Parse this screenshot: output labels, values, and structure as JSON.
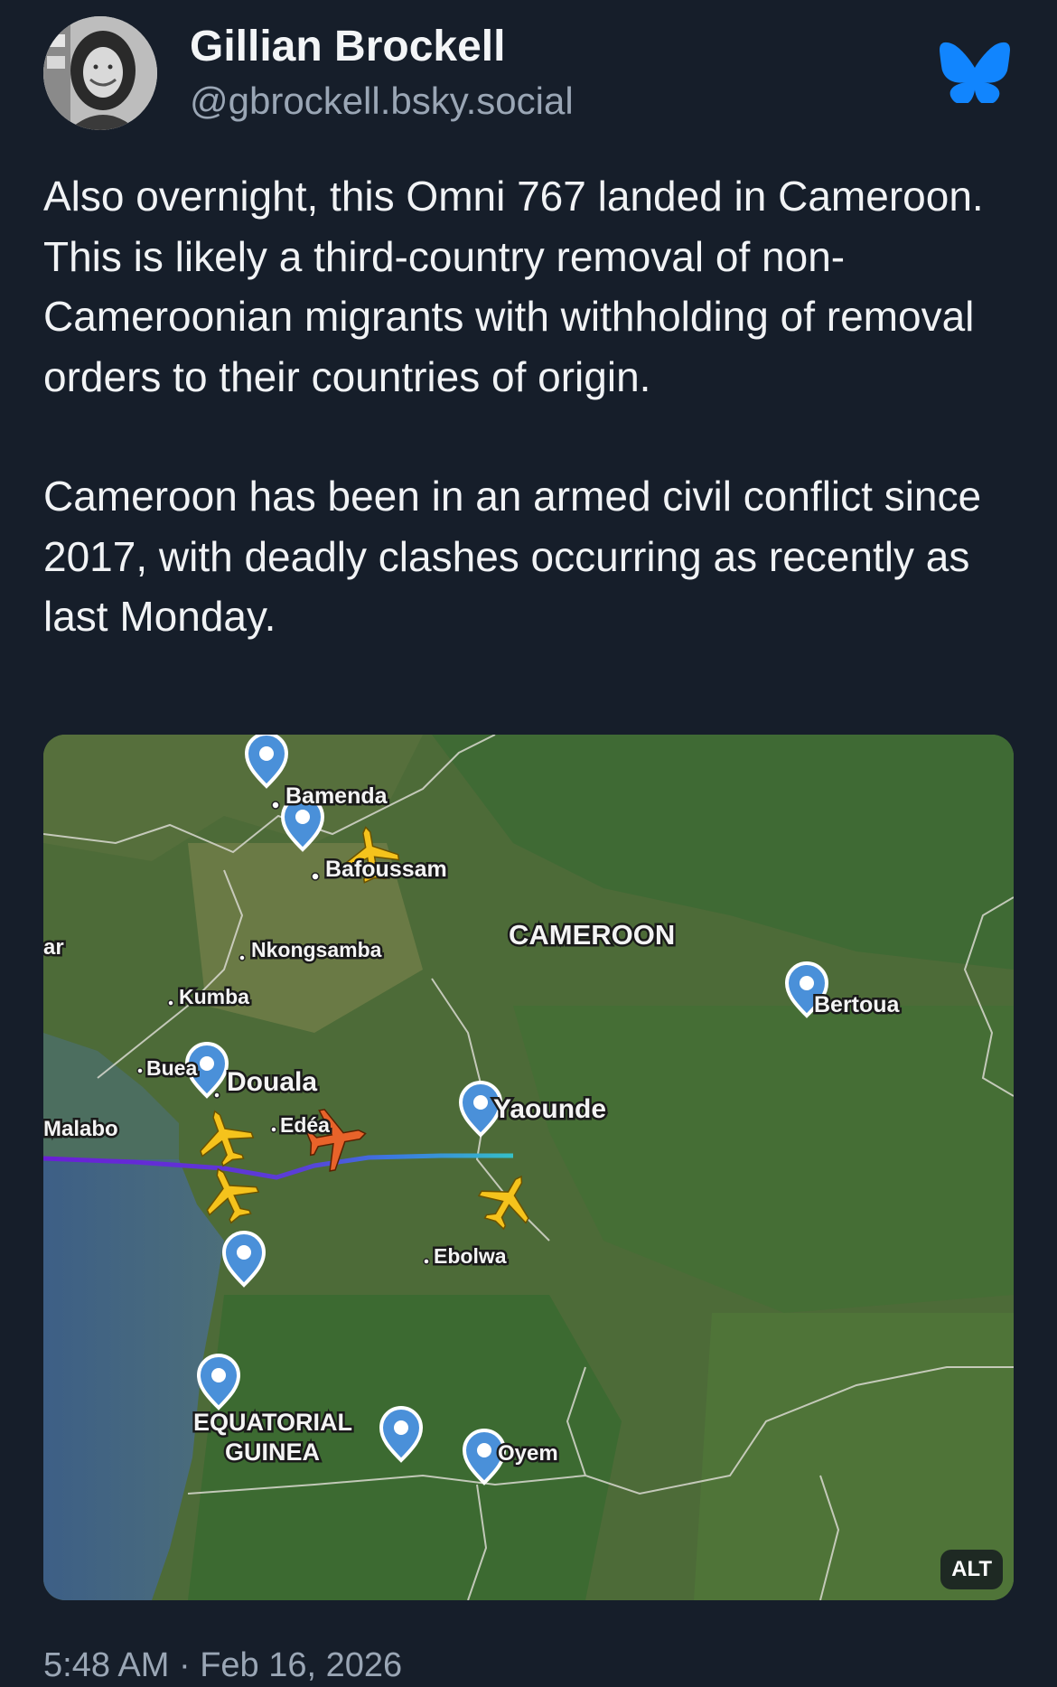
{
  "author": {
    "name": "Gillian Brockell",
    "handle": "@gbrockell.bsky.social"
  },
  "post": {
    "paragraphs": [
      "Also overnight, this Omni 767 landed in Cameroon. This is likely a third-country removal of non-Cameroonian migrants with withholding of removal orders to their countries of origin.",
      "Cameroon has been in an armed civil conflict since 2017, with deadly clashes occurring as recently as last Monday."
    ],
    "timestamp": "5:48 AM",
    "separator": "·",
    "date": "Feb 16, 2026"
  },
  "media": {
    "alt_badge": "ALT",
    "map_labels": {
      "country": "CAMEROON",
      "bamenda": "Bamenda",
      "bafoussam": "Bafoussam",
      "nkongsamba": "Nkongsamba",
      "kumba": "Kumba",
      "buea": "Buea",
      "douala": "Douala",
      "edea": "Edéa",
      "malabo": "Malabo",
      "yaounde": "Yaounde",
      "bertoua": "Bertoua",
      "ebolwa": "Ebolwa",
      "eq_guinea_1": "EQUATORIAL",
      "eq_guinea_2": "GUINEA",
      "oyem": "Oyem",
      "edge_fragment": "ar"
    }
  },
  "colors": {
    "background": "#161e2a",
    "text": "#f1f3f5",
    "muted": "#9aa6b5",
    "bluesky": "#1185fe",
    "flight_plane": "#e8632a",
    "other_planes": "#f5c31c",
    "map_pin": "#4a90d9"
  },
  "icons": {
    "bluesky": "butterfly-icon",
    "map_pin": "map-pin-icon",
    "plane": "airplane-icon"
  }
}
